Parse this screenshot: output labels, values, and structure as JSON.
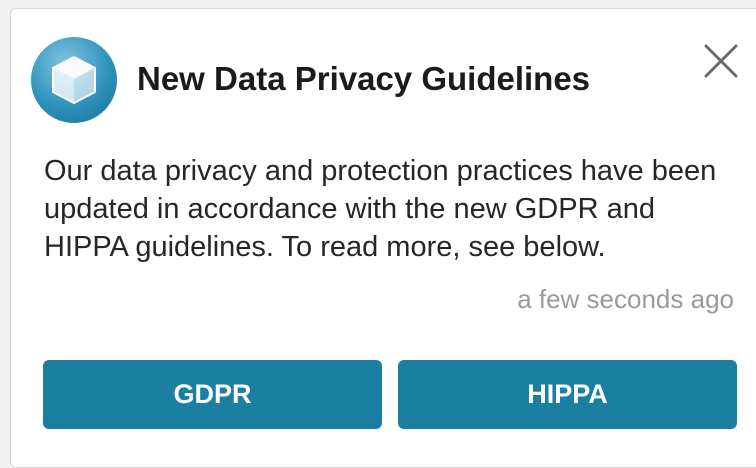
{
  "notification": {
    "title": "New Data Privacy Guidelines",
    "logo_icon": "cube-icon",
    "close_icon": "close-icon",
    "message": "Our data privacy and protection practices have been updated in accordance with the new GDPR and HIPPA guidelines. To read more, see below.",
    "timestamp": "a few seconds ago",
    "buttons": [
      {
        "label": "GDPR"
      },
      {
        "label": "HIPPA"
      }
    ]
  },
  "colors": {
    "accent": "#1a7fa0",
    "logo": "#2c8fb8",
    "timestamp": "#9a9a9a",
    "text": "#262626"
  }
}
